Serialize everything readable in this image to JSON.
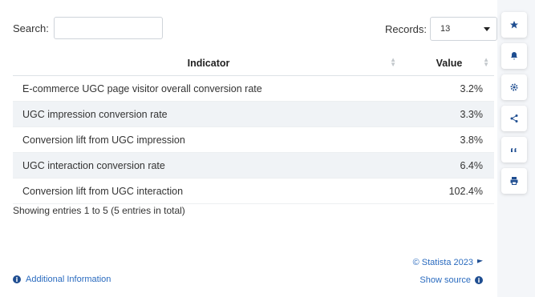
{
  "search": {
    "label": "Search:",
    "value": "",
    "placeholder": ""
  },
  "records": {
    "label": "Records:",
    "value": "13"
  },
  "table": {
    "headers": {
      "indicator": "Indicator",
      "value": "Value"
    },
    "rows": [
      {
        "indicator": "E-commerce UGC page visitor overall conversion rate",
        "value": "3.2%"
      },
      {
        "indicator": "UGC impression conversion rate",
        "value": "3.3%"
      },
      {
        "indicator": "Conversion lift from UGC impression",
        "value": "3.8%"
      },
      {
        "indicator": "UGC interaction conversion rate",
        "value": "6.4%"
      },
      {
        "indicator": "Conversion lift from UGC interaction",
        "value": "102.4%"
      }
    ]
  },
  "summary": "Showing entries 1 to 5 (5 entries in total)",
  "footer": {
    "copyright": "© Statista 2023",
    "additional_info": "Additional Information",
    "show_source": "Show source"
  },
  "sidebar": {
    "icons": [
      "star-icon",
      "bell-icon",
      "gear-icon",
      "share-icon",
      "quote-icon",
      "print-icon"
    ]
  },
  "colors": {
    "accent": "#1f4e91",
    "link": "#2a6bbf",
    "row_alt": "#f0f3f6"
  }
}
